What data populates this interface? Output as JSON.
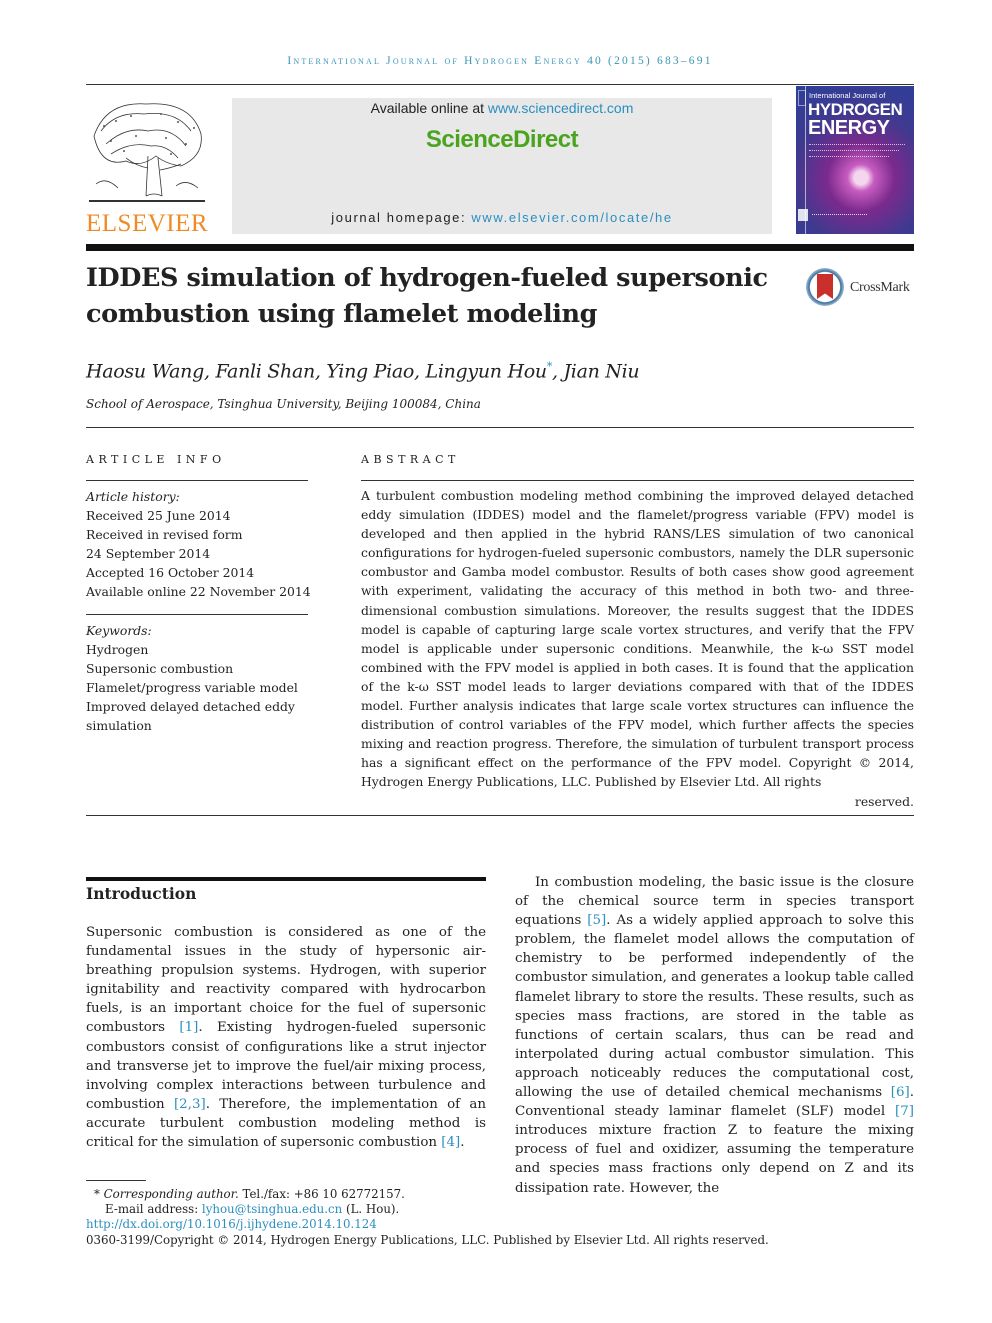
{
  "header": {
    "journal_line": "International Journal of Hydrogen Energy 40 (2015) 683–691",
    "publisher_logo_text": "ELSEVIER",
    "available_online_prefix": "Available online at ",
    "available_online_link": "www.sciencedirect.com",
    "brand": "ScienceDirect",
    "homepage_prefix": "journal homepage: ",
    "homepage_link": "www.elsevier.com/locate/he",
    "cover": {
      "line1": "International Journal of",
      "line2": "HYDROGEN",
      "line3": "ENERGY"
    },
    "colors": {
      "brand_green": "#4ba41e",
      "link_blue": "#2a8fbf",
      "elsevier_orange": "#f08a24",
      "journal_teal": "#3a95b8"
    }
  },
  "article": {
    "title": "IDDES simulation of hydrogen-fueled supersonic combustion using flamelet modeling",
    "crossmark_label": "CrossMark",
    "authors": "Haosu Wang, Fanli Shan, Ying Piao, Lingyun Hou",
    "corresponding_mark": "*",
    "authors_tail": ", Jian Niu",
    "affiliation": "School of Aerospace, Tsinghua University, Beijing 100084, China"
  },
  "article_info": {
    "heading": "ARTICLE INFO",
    "history_label": "Article history:",
    "history": [
      "Received 25 June 2014",
      "Received in revised form",
      "24 September 2014",
      "Accepted 16 October 2014",
      "Available online 22 November 2014"
    ],
    "keywords_label": "Keywords:",
    "keywords": [
      "Hydrogen",
      "Supersonic combustion",
      "Flamelet/progress variable model",
      "Improved delayed detached eddy",
      "simulation"
    ]
  },
  "abstract": {
    "heading": "ABSTRACT",
    "text": "A turbulent combustion modeling method combining the improved delayed detached eddy simulation (IDDES) model and the flamelet/progress variable (FPV) model is developed and then applied in the hybrid RANS/LES simulation of two canonical configurations for hydrogen-fueled supersonic combustors, namely the DLR supersonic combustor and Gamba model combustor. Results of both cases show good agreement with experiment, validating the accuracy of this method in both two- and three-dimensional combustion simulations. Moreover, the results suggest that the IDDES model is capable of capturing large scale vortex structures, and verify that the FPV model is applicable under supersonic conditions. Meanwhile, the k-ω SST model combined with the FPV model is applied in both cases. It is found that the application of the k-ω SST model leads to larger deviations compared with that of the IDDES model. Further analysis indicates that large scale vortex structures can influence the distribution of control variables of the FPV model, which further affects the species mixing and reaction progress. Therefore, the simulation of turbulent transport process has a significant effect on the performance of the FPV model. Copyright © 2014, Hydrogen Energy Publications, LLC. Published by Elsevier Ltd. All rights",
    "text_end": "reserved."
  },
  "introduction": {
    "heading": "Introduction",
    "left_parts": [
      "Supersonic combustion is considered as one of the fundamental issues in the study of hypersonic air-breathing propulsion systems. Hydrogen, with superior ignitability and reactivity compared with hydrocarbon fuels, is an important choice for the fuel of supersonic combustors ",
      "[1]",
      ". Existing hydrogen-fueled supersonic combustors consist of configurations like a strut injector and transverse jet to improve the fuel/air mixing process, involving complex interactions between turbulence and combustion ",
      "[2,3]",
      ". Therefore, the implementation of an accurate turbulent combustion modeling method is critical for the simulation of supersonic combustion ",
      "[4]",
      "."
    ],
    "right_parts": [
      "In combustion modeling, the basic issue is the closure of the chemical source term in species transport equations ",
      "[5]",
      ". As a widely applied approach to solve this problem, the flamelet model allows the computation of chemistry to be performed independently of the combustor simulation, and generates a lookup table called flamelet library to store the results. These results, such as species mass fractions, are stored in the table as functions of certain scalars, thus can be read and interpolated during actual combustor simulation. This approach noticeably reduces the computational cost, allowing the use of detailed chemical mechanisms ",
      "[6]",
      ". Conventional steady laminar flamelet (SLF) model ",
      "[7]",
      " introduces mixture fraction Z to feature the mixing process of fuel and oxidizer, assuming the temperature and species mass fractions only depend on Z and its dissipation rate. However, the"
    ]
  },
  "footnotes": {
    "corresponding_mark": "*",
    "corresponding_label": "Corresponding author.",
    "tel": " Tel./fax: +86 10 62772157.",
    "email_label": "E-mail address: ",
    "email": "lyhou@tsinghua.edu.cn",
    "email_tail": " (L. Hou).",
    "doi": "http://dx.doi.org/10.1016/j.ijhydene.2014.10.124",
    "copyright": "0360-3199/Copyright © 2014, Hydrogen Energy Publications, LLC. Published by Elsevier Ltd. All rights reserved."
  }
}
